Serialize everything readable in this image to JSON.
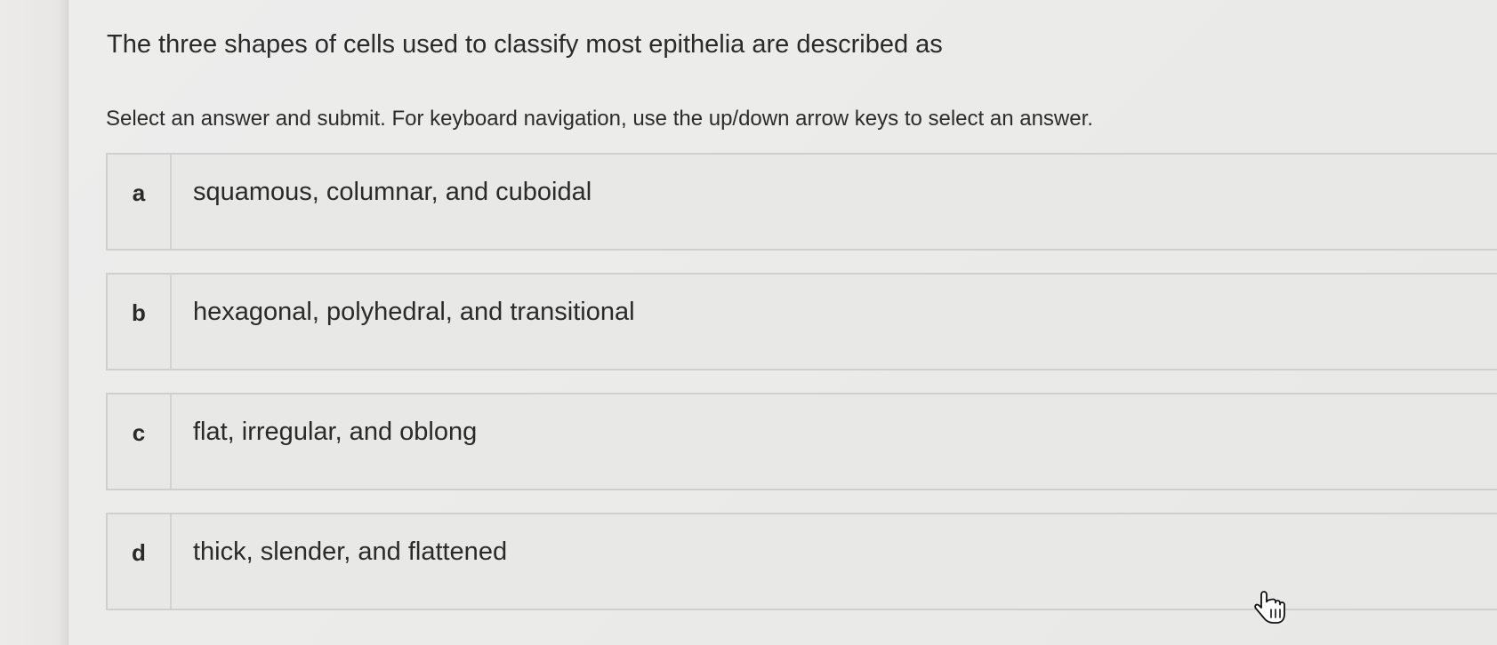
{
  "question": {
    "prompt": "The three shapes of cells used to classify most epithelia are described as"
  },
  "instructions": "Select an answer and submit. For keyboard navigation, use the up/down arrow keys to select an answer.",
  "options": [
    {
      "letter": "a",
      "text": "squamous, columnar, and cuboidal"
    },
    {
      "letter": "b",
      "text": "hexagonal, polyhedral, and transitional"
    },
    {
      "letter": "c",
      "text": "flat, irregular, and oblong"
    },
    {
      "letter": "d",
      "text": "thick, slender, and flattened"
    }
  ],
  "cursor": {
    "icon": "hand-pointer-icon"
  }
}
